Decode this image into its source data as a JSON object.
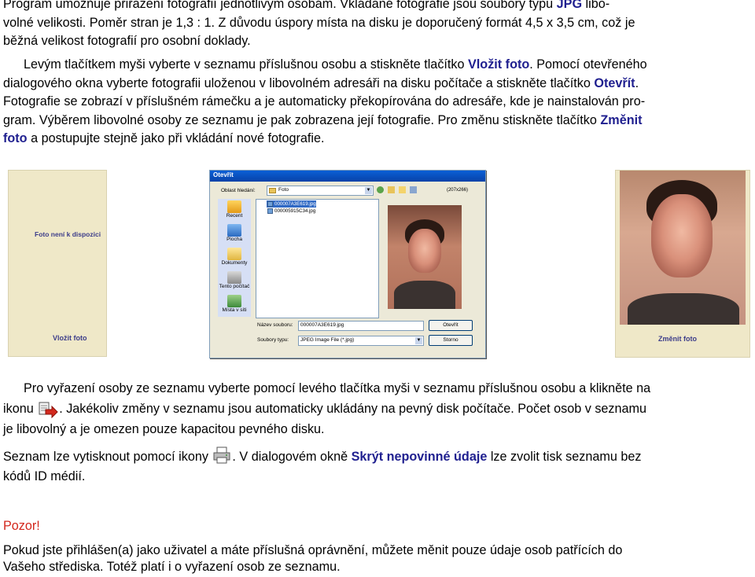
{
  "paragraph1": {
    "line1": "Program umožňuje přiřazení fotografií jednotlivým osobám. Vkládané fotografie jsou soubory typu",
    "format": "JPG",
    "line1_end": "libo-",
    "line2": "volné velikosti. Poměr stran je 1,3 : 1. Z důvodu úspory místa na disku je doporučený formát  4,5 x 3,5 cm, což je",
    "line3": "běžná velikost fotografií pro osobní doklady."
  },
  "paragraph2": {
    "t1": "Levým tlačítkem myši vyberte v seznamu příslušnou osobu a stiskněte tlačítko",
    "b1": "Vložit foto",
    "t2": ". Pomocí otevřeného",
    "t3": "dialogového okna vyberte fotografii uloženou v libovolném adresáři na disku počítače a stiskněte tlačítko",
    "b2": "Otevřít",
    "t4": ".",
    "t5": "Fotografie se zobrazí v příslušném rámečku a je automaticky překopírována do adresáře, kde je nainstalován pro-",
    "t6": "gram. Výběrem libovolné osoby ze seznamu je pak zobrazena její fotografie. Pro změnu stiskněte tlačítko",
    "b3a": "Změnit",
    "b3b": "foto",
    "t7": "a postupujte stejně jako při vkládání nové fotografie."
  },
  "left_panel": {
    "placeholder_text": "Foto není k dispozici",
    "button_label": "Vložit foto"
  },
  "dialog": {
    "title": "Otevřít",
    "look_in_label": "Oblast hledání:",
    "look_in_value": "Foto",
    "dims": "(207x266)",
    "side_items": [
      "Recent",
      "Plocha",
      "Dokumenty",
      "Tento počítač",
      "Místa v síti"
    ],
    "files": [
      "000007A3E619.jpg",
      "000005915C34.jpg"
    ],
    "filename_label": "Název souboru:",
    "filename_value": "000007A3E619.jpg",
    "filetype_label": "Soubory typu:",
    "filetype_value": "JPEG Image File (*.jpg)",
    "open_button": "Otevřít",
    "cancel_button": "Storno"
  },
  "right_panel": {
    "button_label": "Změnit foto"
  },
  "paragraph3": {
    "t1": "Pro vyřazení osoby ze seznamu vyberte pomocí levého tlačítka myši v seznamu příslušnou osobu a klikněte na",
    "t2": "ikonu",
    "t3": ". Jakékoliv změny v seznamu jsou automaticky ukládány na pevný disk počítače. Počet osob v seznamu",
    "t4": "je libovolný a je omezen pouze kapacitou pevného disku."
  },
  "paragraph4": {
    "t1": "Seznam lze vytisknout pomocí ikony",
    "t2": ". V dialogovém okně",
    "b1": "Skrýt nepovinné údaje",
    "t3": "lze zvolit tisk seznamu bez",
    "t4": "kódů ID médií."
  },
  "warning": {
    "heading": "Pozor!",
    "line1": "Pokud jste přihlášen(a) jako uživatel a máte příslušná oprávnění, můžete měnit pouze údaje osob patřících do",
    "line2": "Vašeho střediska. Totéž platí i o vyřazení osob ze seznamu."
  },
  "colors": {
    "highlight": "#1f1f8f",
    "warning": "#d3271c",
    "panel_bg": "#efe8c8"
  },
  "icons": [
    "delete-person-icon",
    "print-icon"
  ]
}
